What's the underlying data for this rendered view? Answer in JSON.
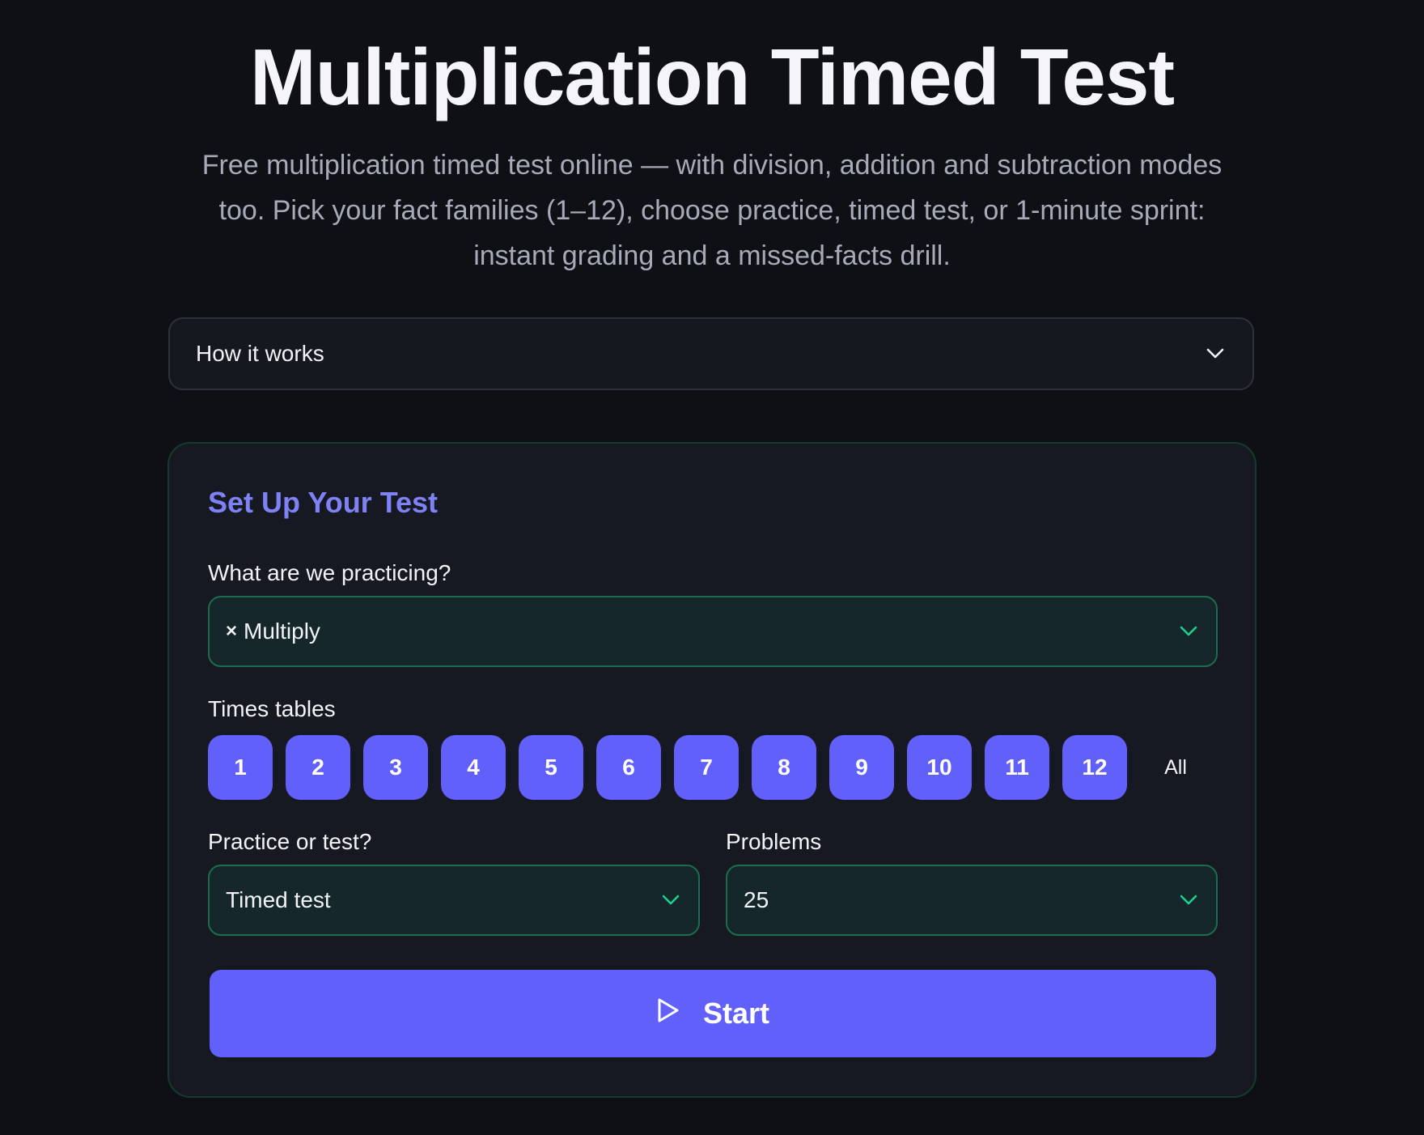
{
  "header": {
    "title": "Multiplication Timed Test",
    "subtitle": "Free multiplication timed test online — with division, addition and subtraction modes too. Pick your fact families (1–12), choose practice, timed test, or 1-minute sprint: instant grading and a missed-facts drill."
  },
  "how_it_works": {
    "label": "How it works",
    "icon": "chevron-down-icon"
  },
  "setup": {
    "title": "Set Up Your Test",
    "operation": {
      "label": "What are we practicing?",
      "symbol": "×",
      "value": "Multiply"
    },
    "tables": {
      "label": "Times tables",
      "items": [
        "1",
        "2",
        "3",
        "4",
        "5",
        "6",
        "7",
        "8",
        "9",
        "10",
        "11",
        "12"
      ],
      "all_label": "All"
    },
    "mode": {
      "label": "Practice or test?",
      "value": "Timed test"
    },
    "problems": {
      "label": "Problems",
      "value": "25"
    },
    "start": {
      "label": "Start",
      "icon": "play-icon"
    }
  },
  "colors": {
    "accent": "#6160fb",
    "accent_text": "#7e82f5",
    "select_border": "#1e6b4f",
    "select_chevron": "#1fcf8f",
    "background": "#0e1015"
  }
}
